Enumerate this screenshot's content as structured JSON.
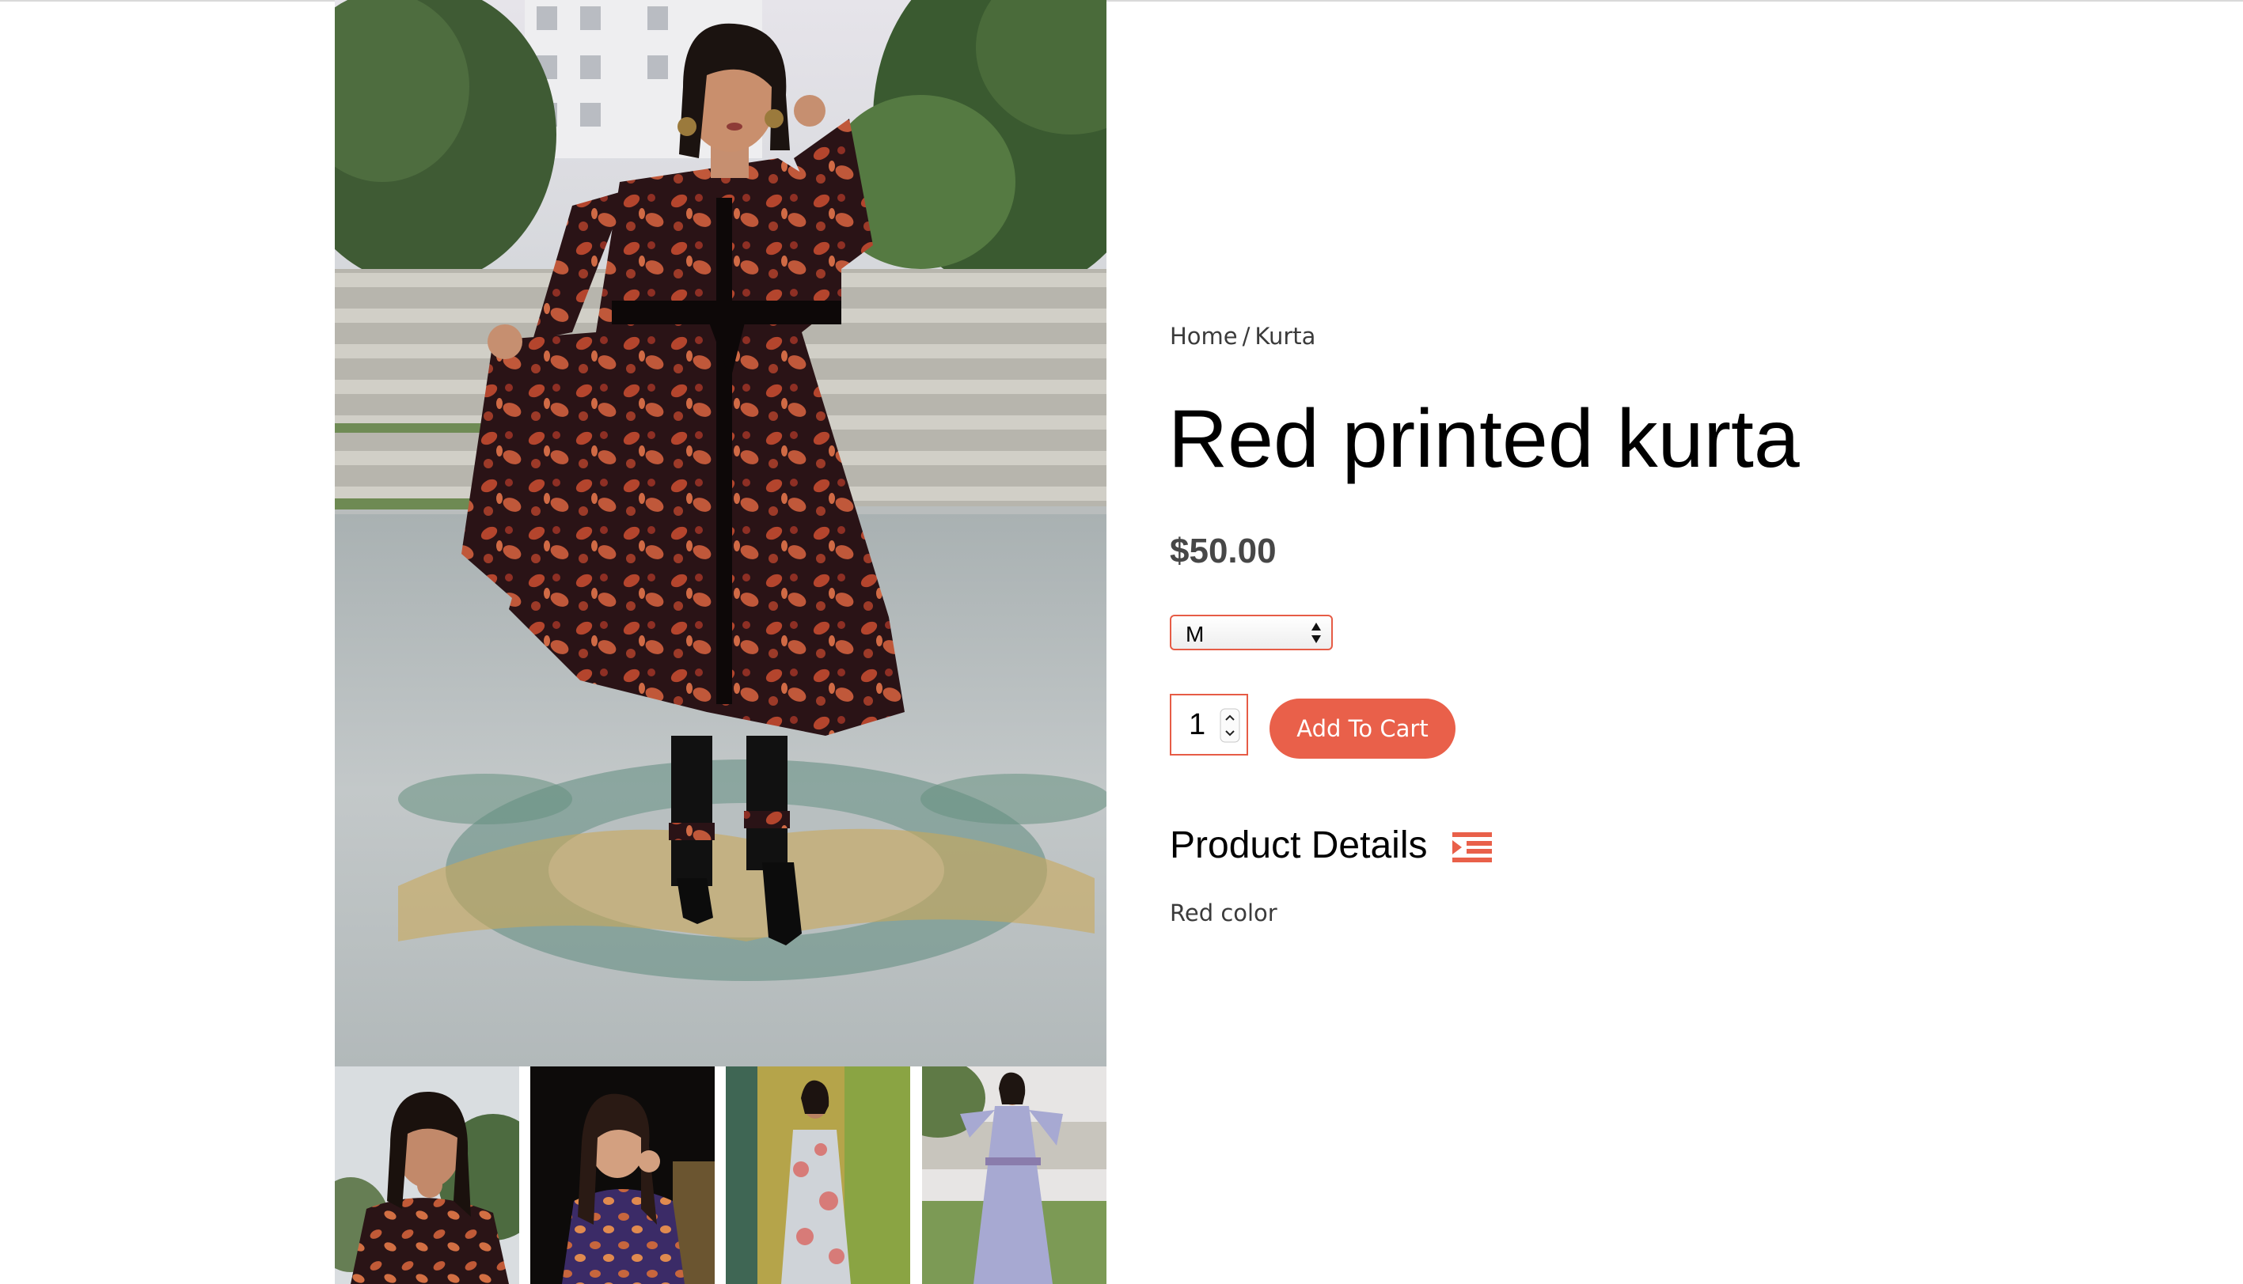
{
  "breadcrumb": {
    "home": "Home",
    "separator": "/",
    "category": "Kurta"
  },
  "product": {
    "title": "Red printed kurta",
    "price": "$50.00",
    "size_selected": "M",
    "quantity": "1",
    "add_to_cart_label": "Add To Cart"
  },
  "details": {
    "heading": "Product Details",
    "text": "Red color"
  },
  "icons": {
    "size_dropdown": "select-arrows-icon",
    "quantity": "stepper-arrows-icon",
    "details": "indent-list-icon"
  },
  "colors": {
    "accent": "#e9604a",
    "text_dark": "#000000",
    "text_muted": "#3b3b3b",
    "price": "#474747"
  },
  "gallery": {
    "main_image": "woman in black and red paisley printed kurta with black pants",
    "thumbnails": [
      "close-up of woman in black and orange printed kurta",
      "woman in purple printed kurta at night",
      "woman in pink floral kurta",
      "woman in light lavender long kurta"
    ]
  }
}
